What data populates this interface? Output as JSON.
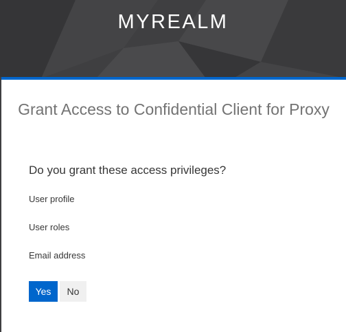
{
  "header": {
    "realm_name": "MYREALM"
  },
  "consent": {
    "title": "Grant Access to Confidential Client for Proxy",
    "question": "Do you grant these access privileges?",
    "privileges": [
      "User profile",
      "User roles",
      "Email address"
    ],
    "accept_label": "Yes",
    "decline_label": "No"
  },
  "colors": {
    "accent": "#0066cc",
    "header_bg": "#3f3f41"
  }
}
